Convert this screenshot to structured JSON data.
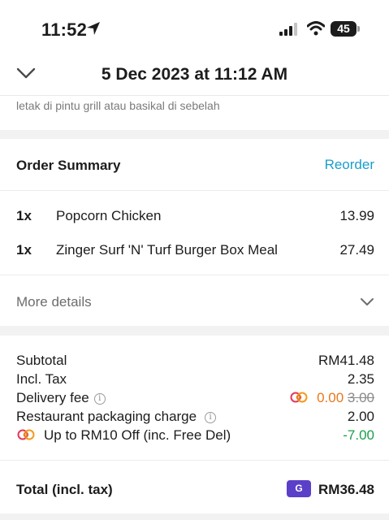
{
  "status_bar": {
    "time": "11:52",
    "battery": "45",
    "location_icon": "location-arrow-icon",
    "signal_icon": "cellular-signal-icon",
    "wifi_icon": "wifi-icon"
  },
  "header": {
    "title": "5 Dec 2023 at 11:12 AM",
    "back_icon": "chevron-down-icon"
  },
  "delivery_note": "letak di pintu grill atau basikal di sebelah",
  "order_summary": {
    "title": "Order Summary",
    "reorder_label": "Reorder",
    "items": [
      {
        "qty": "1x",
        "name": "Popcorn Chicken",
        "price": "13.99"
      },
      {
        "qty": "1x",
        "name": "Zinger Surf 'N' Turf Burger Box Meal",
        "price": "27.49"
      }
    ],
    "more_details_label": "More details"
  },
  "charges": {
    "subtotal_label": "Subtotal",
    "subtotal_value": "RM41.48",
    "tax_label": "Incl. Tax",
    "tax_value": "2.35",
    "delivery_label": "Delivery fee",
    "delivery_value": "0.00",
    "delivery_original": "3.00",
    "packaging_label": "Restaurant packaging charge",
    "packaging_value": "2.00",
    "promo_label": "Up to RM10 Off (inc. Free Del)",
    "promo_value": "-7.00",
    "info_icon": "i"
  },
  "total": {
    "label": "Total (incl. tax)",
    "payment_badge": "G",
    "value": "RM36.48"
  },
  "colors": {
    "accent_blue": "#1a9dcc",
    "discount_orange": "#e8781d",
    "discount_green": "#1a9e4a",
    "payment_purple": "#5b3fc9"
  }
}
